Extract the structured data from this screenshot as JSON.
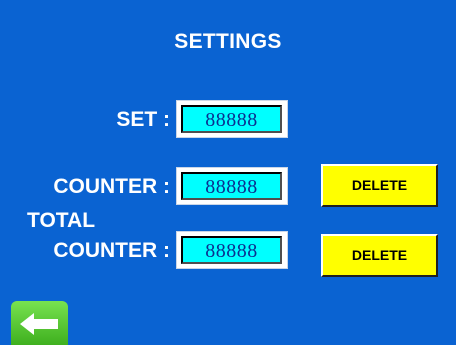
{
  "screen": {
    "title": "SETTINGS",
    "background_color": "#0a63d2"
  },
  "set": {
    "label": "SET :",
    "value": "88888"
  },
  "counter": {
    "label": "COUNTER :",
    "value": "88888",
    "delete_label": "DELETE"
  },
  "total_counter": {
    "label_line1": "TOTAL",
    "label_line2": "COUNTER :",
    "value": "88888",
    "delete_label": "DELETE"
  },
  "back_button": {
    "icon": "arrow-left-icon",
    "color": "#4cc72a"
  },
  "colors": {
    "field_fill": "#00ffff",
    "field_text": "#0b2f8f",
    "delete_button": "#ffff00"
  }
}
